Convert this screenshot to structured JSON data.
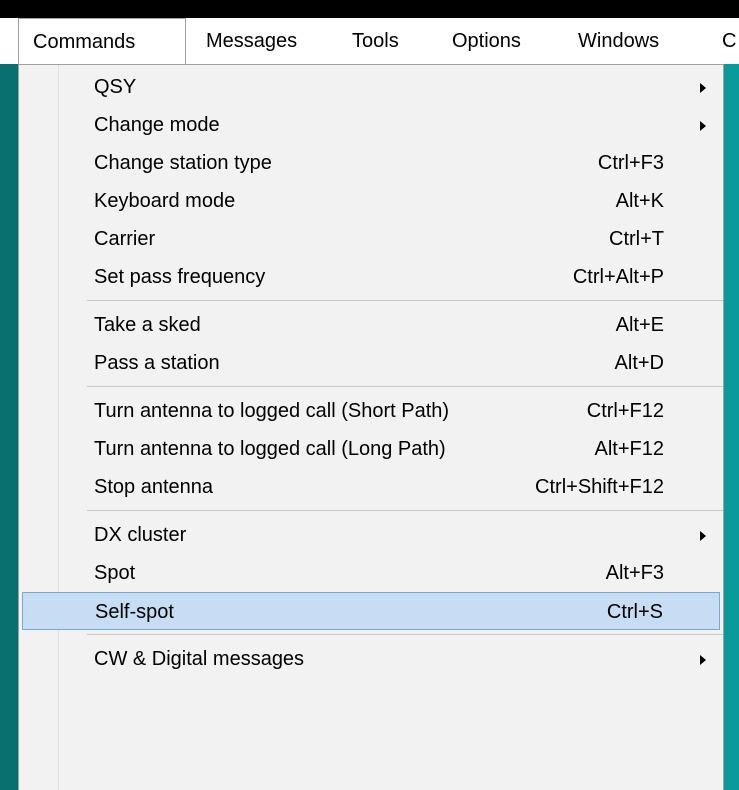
{
  "menubar": {
    "items": [
      "Commands",
      "Messages",
      "Tools",
      "Options",
      "Windows",
      "C"
    ],
    "active_index": 0
  },
  "dropdown": {
    "items": [
      {
        "label": "QSY",
        "shortcut": "",
        "submenu": true
      },
      {
        "label": "Change mode",
        "shortcut": "",
        "submenu": true
      },
      {
        "label": "Change station type",
        "shortcut": "Ctrl+F3",
        "submenu": false
      },
      {
        "label": "Keyboard mode",
        "shortcut": "Alt+K",
        "submenu": false
      },
      {
        "label": "Carrier",
        "shortcut": "Ctrl+T",
        "submenu": false
      },
      {
        "label": "Set pass frequency",
        "shortcut": "Ctrl+Alt+P",
        "submenu": false,
        "separator_after": true
      },
      {
        "label": "Take a sked",
        "shortcut": "Alt+E",
        "submenu": false
      },
      {
        "label": "Pass a station",
        "shortcut": "Alt+D",
        "submenu": false,
        "separator_after": true
      },
      {
        "label": "Turn antenna to logged call (Short Path)",
        "shortcut": "Ctrl+F12",
        "submenu": false
      },
      {
        "label": "Turn antenna to logged call (Long Path)",
        "shortcut": "Alt+F12",
        "submenu": false
      },
      {
        "label": "Stop antenna",
        "shortcut": "Ctrl+Shift+F12",
        "submenu": false,
        "separator_after": true
      },
      {
        "label": "DX cluster",
        "shortcut": "",
        "submenu": true
      },
      {
        "label": "Spot",
        "shortcut": "Alt+F3",
        "submenu": false
      },
      {
        "label": "Self-spot",
        "shortcut": "Ctrl+S",
        "submenu": false,
        "highlighted": true,
        "separator_after": true
      },
      {
        "label": "CW & Digital messages",
        "shortcut": "",
        "submenu": true
      }
    ]
  },
  "colors": {
    "menu_background": "#f2f2f2",
    "highlight_fill": "#c6ddf3",
    "highlight_border": "#7aa7d6",
    "window_background": "#0b9a9a"
  }
}
